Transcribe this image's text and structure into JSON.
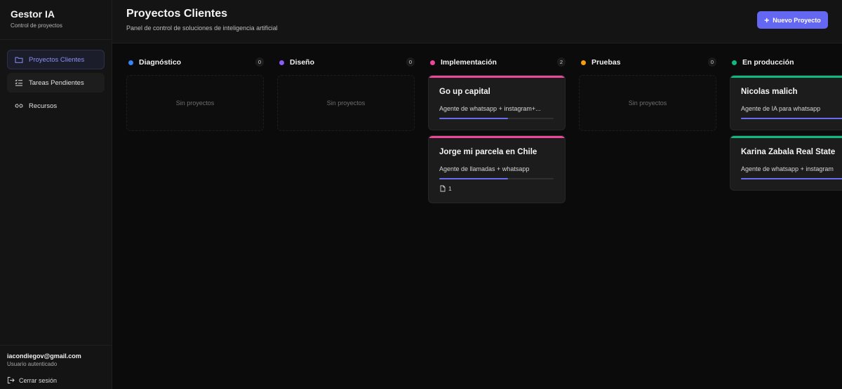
{
  "sidebar": {
    "brand_title": "Gestor IA",
    "brand_subtitle": "Control de proyectos",
    "items": [
      {
        "label": "Proyectos Clientes",
        "icon": "folder-icon",
        "active": true
      },
      {
        "label": "Tareas Pendientes",
        "icon": "list-checks-icon",
        "active": false
      },
      {
        "label": "Recursos",
        "icon": "link-icon",
        "active": false
      }
    ],
    "user_email": "iacondiegov@gmail.com",
    "user_status": "Usuario autenticado",
    "logout_label": "Cerrar sesión"
  },
  "header": {
    "title": "Proyectos Clientes",
    "subtitle": "Panel de control de soluciones de inteligencia artificial",
    "new_button_label": "Nuevo Proyecto"
  },
  "colors": {
    "accent": "#6467f2",
    "diagnostico": "#3b82f6",
    "diseno": "#8b5cf6",
    "implementacion": "#ec4899",
    "pruebas": "#f59e0b",
    "produccion": "#10b981"
  },
  "columns": [
    {
      "title": "Diagnóstico",
      "count": "0",
      "empty_label": "Sin proyectos",
      "cards": []
    },
    {
      "title": "Diseño",
      "count": "0",
      "empty_label": "Sin proyectos",
      "cards": []
    },
    {
      "title": "Implementación",
      "count": "2",
      "cards": [
        {
          "title": "Go up capital",
          "description": "Agente de whatsapp + instagram+...",
          "progress": 0.6
        },
        {
          "title": "Jorge mi parcela en Chile",
          "description": "Agente de llamadas + whatsapp",
          "progress": 0.6,
          "attachments": "1"
        }
      ]
    },
    {
      "title": "Pruebas",
      "count": "0",
      "empty_label": "Sin proyectos",
      "cards": []
    },
    {
      "title": "En producción",
      "cards": [
        {
          "title": "Nicolas malich",
          "description": "Agente de IA para whatsapp",
          "progress": 1.0
        },
        {
          "title": "Karina Zabala Real State",
          "description": "Agente de whatsapp + instagram",
          "progress": 1.0
        }
      ]
    }
  ]
}
